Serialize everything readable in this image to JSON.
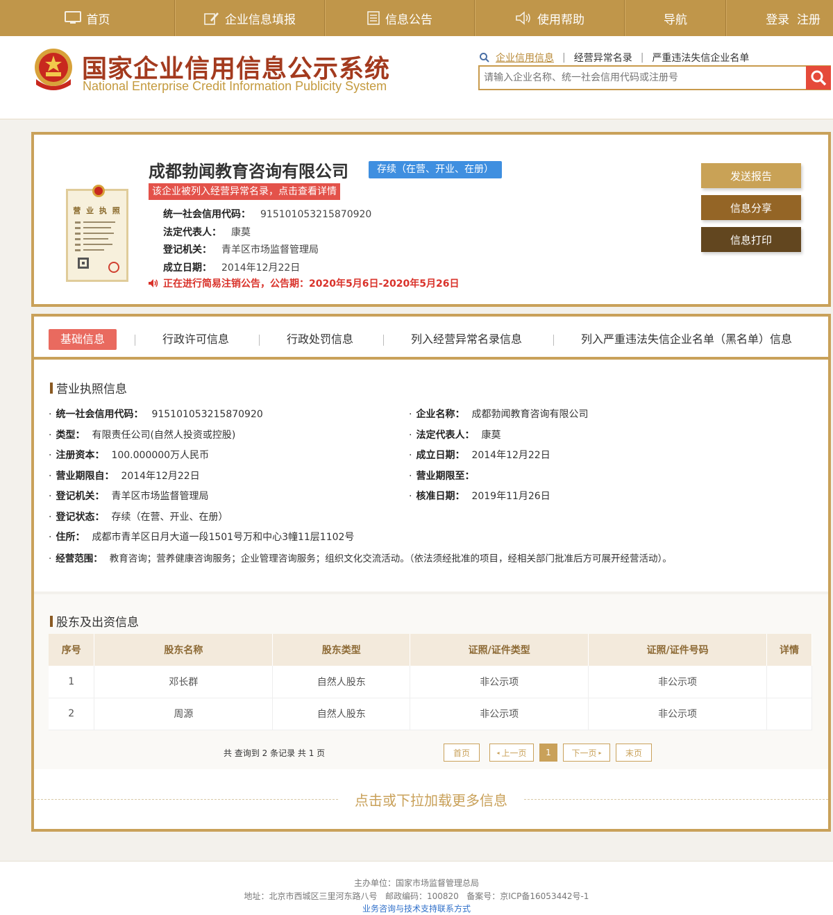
{
  "nav": {
    "items": [
      {
        "label": "首页",
        "icon": "monitor-icon"
      },
      {
        "label": "企业信息填报",
        "icon": "edit-icon"
      },
      {
        "label": "信息公告",
        "icon": "document-icon"
      },
      {
        "label": "使用帮助",
        "icon": "speaker-icon"
      },
      {
        "label": "导航"
      },
      {
        "label": "登录  注册"
      }
    ]
  },
  "header": {
    "title": "国家企业信用信息公示系统",
    "subtitle": "National Enterprise Credit Information Publicity System",
    "search_links": [
      "企业信用信息",
      "经营异常名录",
      "严重违法失信企业名单"
    ],
    "search_placeholder": "请输入企业名称、统一社会信用代码或注册号"
  },
  "company": {
    "name": "成都勃闻教育咨询有限公司",
    "status": "存续（在营、开业、在册）",
    "abnormal_notice": "该企业被列入经营异常名录，点击查看详情",
    "license_title": "营 业 执 照",
    "fields": [
      {
        "label": "统一社会信用代码：",
        "value": "915101053215870920"
      },
      {
        "label": "法定代表人：",
        "value": "康莫"
      },
      {
        "label": "登记机关：",
        "value": "青羊区市场监督管理局"
      },
      {
        "label": "成立日期：",
        "value": "2014年12月22日"
      }
    ],
    "cancel_notice": "正在进行简易注销公告，公告期：2020年5月6日-2020年5月26日",
    "buttons": {
      "report": "发送报告",
      "share": "信息分享",
      "print": "信息打印"
    }
  },
  "tabs": [
    "基础信息",
    "行政许可信息",
    "行政处罚信息",
    "列入经营异常名录信息",
    "列入严重违法失信企业名单（黑名单）信息"
  ],
  "license_info": {
    "title": "营业执照信息",
    "left": [
      {
        "label": "统一社会信用代码：",
        "value": "915101053215870920"
      },
      {
        "label": "类型：",
        "value": "有限责任公司(自然人投资或控股)"
      },
      {
        "label": "注册资本：",
        "value": "100.000000万人民币"
      },
      {
        "label": "营业期限自：",
        "value": "2014年12月22日"
      },
      {
        "label": "登记机关：",
        "value": "青羊区市场监督管理局"
      },
      {
        "label": "登记状态：",
        "value": "存续（在营、开业、在册）"
      },
      {
        "label": "住所：",
        "value": "成都市青羊区日月大道一段1501号万和中心3幢11层1102号"
      },
      {
        "label": "经营范围：",
        "value": "教育咨询；营养健康咨询服务；企业管理咨询服务；组织文化交流活动。（依法须经批准的项目，经相关部门批准后方可展开经营活动）。"
      }
    ],
    "right": [
      {
        "label": "企业名称：",
        "value": "成都勃闻教育咨询有限公司"
      },
      {
        "label": "法定代表人：",
        "value": "康莫"
      },
      {
        "label": "成立日期：",
        "value": "2014年12月22日"
      },
      {
        "label": "营业期限至：",
        "value": ""
      },
      {
        "label": "核准日期：",
        "value": "2019年11月26日"
      }
    ]
  },
  "shareholders": {
    "title": "股东及出资信息",
    "headers": [
      "序号",
      "股东名称",
      "股东类型",
      "证照/证件类型",
      "证照/证件号码",
      "详情"
    ],
    "rows": [
      [
        "1",
        "邓长群",
        "自然人股东",
        "非公示项",
        "非公示项",
        ""
      ],
      [
        "2",
        "周源",
        "自然人股东",
        "非公示项",
        "非公示项",
        ""
      ]
    ],
    "pager_info": "共 查询到 2 条记录 共 1 页",
    "pager": {
      "first": "首页",
      "prev": "上一页",
      "current": "1",
      "next": "下一页",
      "last": "末页"
    }
  },
  "load_more": "点击或下拉加载更多信息",
  "footer": {
    "line1": "主办单位：国家市场监督管理总局",
    "line2": "地址：北京市西城区三里河东路八号   邮政编码：100820   备案号：京ICP备16053442号-1",
    "line3": "业务咨询与技术支持联系方式"
  },
  "colors": {
    "gold": "#c9a15a",
    "nav": "#c0964a",
    "title_red": "#a33a1e",
    "notice_red": "#d9322a",
    "status_blue": "#3f8fe0"
  }
}
